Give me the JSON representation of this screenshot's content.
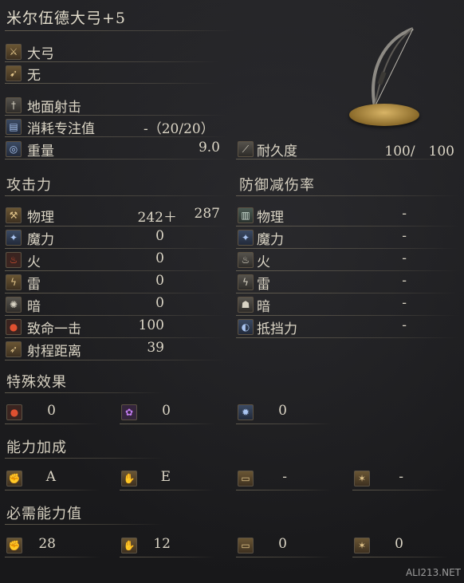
{
  "title": "米尔伍德大弓+5",
  "header": {
    "weapon_type": "大弓",
    "attack_type": "无",
    "skill": "地面射击",
    "fp_cost_label": "消耗专注值",
    "fp_cost_value": "-（20/20）",
    "weight_label": "重量",
    "weight_value": "9.0",
    "durability_label": "耐久度",
    "durability_value": "100/　100"
  },
  "attack": {
    "section_title": "攻击力",
    "rows": [
      {
        "icon": "physical-icon",
        "label": "物理",
        "value": "242＋",
        "extra": "287"
      },
      {
        "icon": "magic-icon",
        "label": "魔力",
        "value": "0"
      },
      {
        "icon": "fire-icon",
        "label": "火",
        "value": "0"
      },
      {
        "icon": "lightning-icon",
        "label": "雷",
        "value": "0"
      },
      {
        "icon": "dark-icon",
        "label": "暗",
        "value": "0"
      },
      {
        "icon": "critical-icon",
        "label": "致命一击",
        "value": "100"
      },
      {
        "icon": "range-icon",
        "label": "射程距离",
        "value": "39"
      }
    ]
  },
  "defense": {
    "section_title": "防御减伤率",
    "rows": [
      {
        "icon": "physical-icon",
        "label": "物理",
        "value": "-"
      },
      {
        "icon": "magic-icon",
        "label": "魔力",
        "value": "-"
      },
      {
        "icon": "fire-icon",
        "label": "火",
        "value": "-"
      },
      {
        "icon": "lightning-icon",
        "label": "雷",
        "value": "-"
      },
      {
        "icon": "dark-icon",
        "label": "暗",
        "value": "-"
      },
      {
        "icon": "stability-icon",
        "label": "抵挡力",
        "value": "-"
      }
    ]
  },
  "special": {
    "section_title": "特殊效果",
    "items": [
      {
        "icon": "bleed-icon",
        "value": "0"
      },
      {
        "icon": "poison-icon",
        "value": "0"
      },
      {
        "icon": "frost-icon",
        "value": "0"
      }
    ]
  },
  "scaling": {
    "section_title": "能力加成",
    "items": [
      {
        "icon": "strength-icon",
        "value": "A"
      },
      {
        "icon": "dexterity-icon",
        "value": "E"
      },
      {
        "icon": "intelligence-icon",
        "value": "-"
      },
      {
        "icon": "faith-icon",
        "value": "-"
      }
    ]
  },
  "requirements": {
    "section_title": "必需能力值",
    "items": [
      {
        "icon": "strength-icon",
        "value": "28"
      },
      {
        "icon": "dexterity-icon",
        "value": "12"
      },
      {
        "icon": "intelligence-icon",
        "value": "0"
      },
      {
        "icon": "faith-icon",
        "value": "0"
      }
    ]
  },
  "watermark": "ALI213.NET"
}
